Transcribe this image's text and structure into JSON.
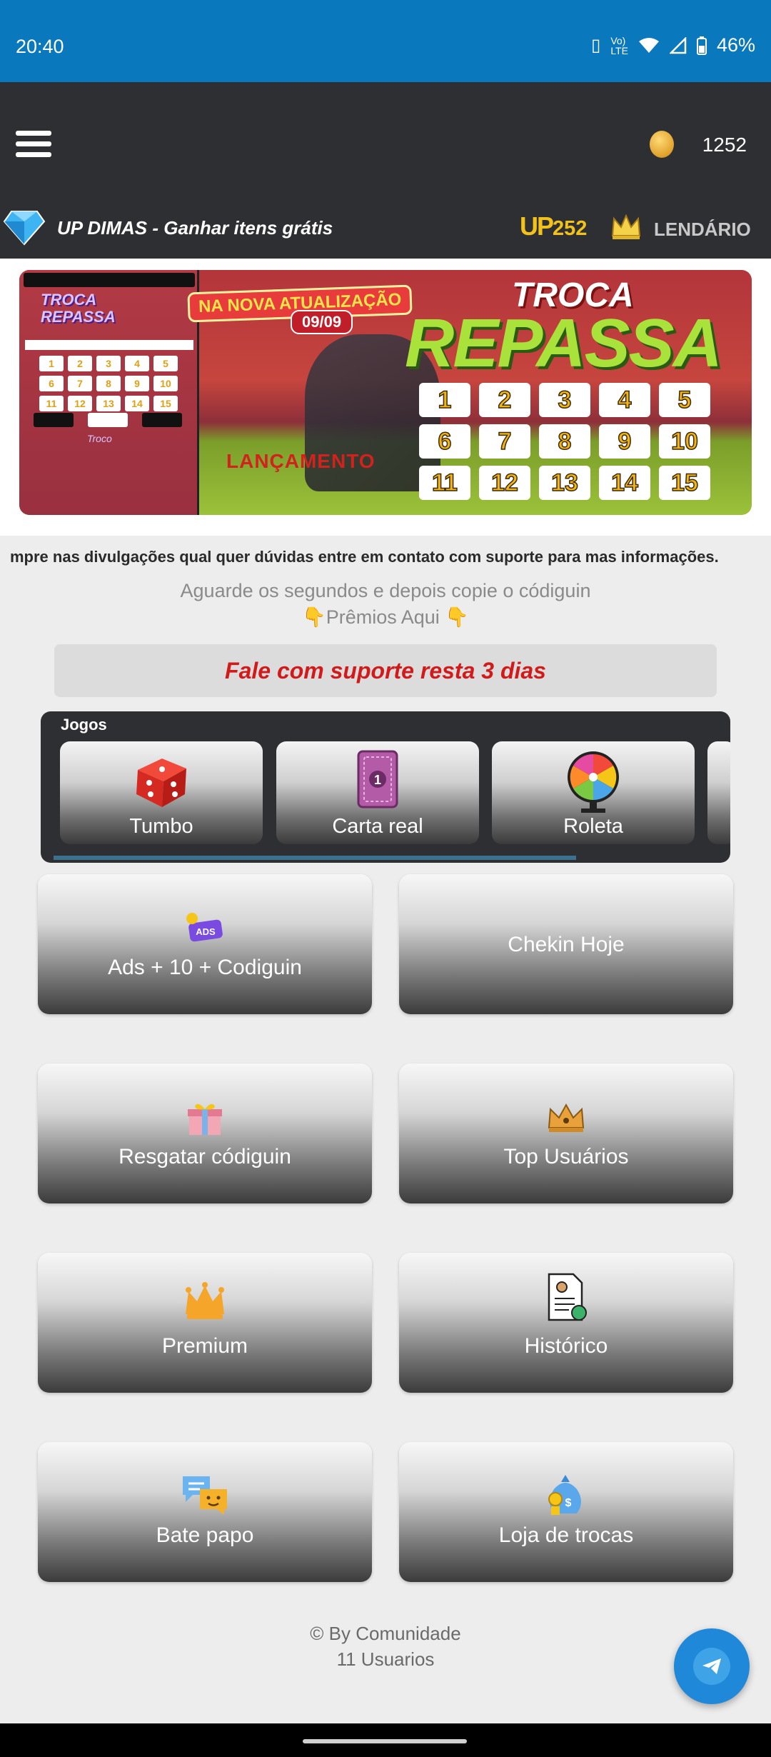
{
  "status": {
    "time": "20:40",
    "battery": "46%",
    "icons": [
      "vibrate-icon",
      "volte-icon",
      "wifi-icon",
      "signal-icon",
      "battery-icon"
    ]
  },
  "appbar": {
    "coins": "1252",
    "title": "UP DIMAS - Ganhar itens grátis",
    "up_logo": "UP",
    "up_value": "252",
    "rank": "LENDÁRIO"
  },
  "banner": {
    "left_title_1": "TROCA",
    "left_title_2": "REPASSA",
    "left_troco": "Troco",
    "subtitle": "NA NOVA ATUALIZAÇÃO",
    "date": "09/09",
    "title_1": "TROCA",
    "title_2": "REPASSA",
    "launch": "LANÇAMENTO",
    "numbers": [
      "1",
      "2",
      "3",
      "4",
      "5",
      "6",
      "7",
      "8",
      "9",
      "10",
      "11",
      "12",
      "13",
      "14",
      "15"
    ]
  },
  "ticker": "mpre nas divulgações qual quer dúvidas entre em contato com suporte para mas informações.",
  "wait_text": "Aguarde os segundos e depois copie o códiguin",
  "prizes_text": "👇Prêmios Aqui 👇",
  "support_text": "Fale com suporte resta 3 dias",
  "games": {
    "label": "Jogos",
    "items": [
      {
        "label": "Tumbo",
        "icon": "dice-icon"
      },
      {
        "label": "Carta real",
        "icon": "card-icon"
      },
      {
        "label": "Roleta",
        "icon": "wheel-icon"
      }
    ]
  },
  "tiles": [
    {
      "label": "Ads + 10 + Codiguin",
      "icon": "ads-icon"
    },
    {
      "label": "Chekin Hoje",
      "icon": ""
    },
    {
      "label": "Resgatar códiguin",
      "icon": "gift-icon"
    },
    {
      "label": "Top Usuários",
      "icon": "crown-icon"
    },
    {
      "label": "Premium",
      "icon": "premium-crown-icon"
    },
    {
      "label": "Histórico",
      "icon": "history-document-icon"
    },
    {
      "label": "Bate papo",
      "icon": "chat-icon"
    },
    {
      "label": "Loja de trocas",
      "icon": "money-bag-icon"
    }
  ],
  "footer": {
    "line1": "© By Comunidade",
    "line2": "11 Usuarios"
  },
  "colors": {
    "status_bar": "#0a78bc",
    "app_bar": "#2e2f33",
    "accent_gold": "#f2c21a",
    "support_red": "#d11a1a",
    "fab_blue": "#1f88d8"
  }
}
